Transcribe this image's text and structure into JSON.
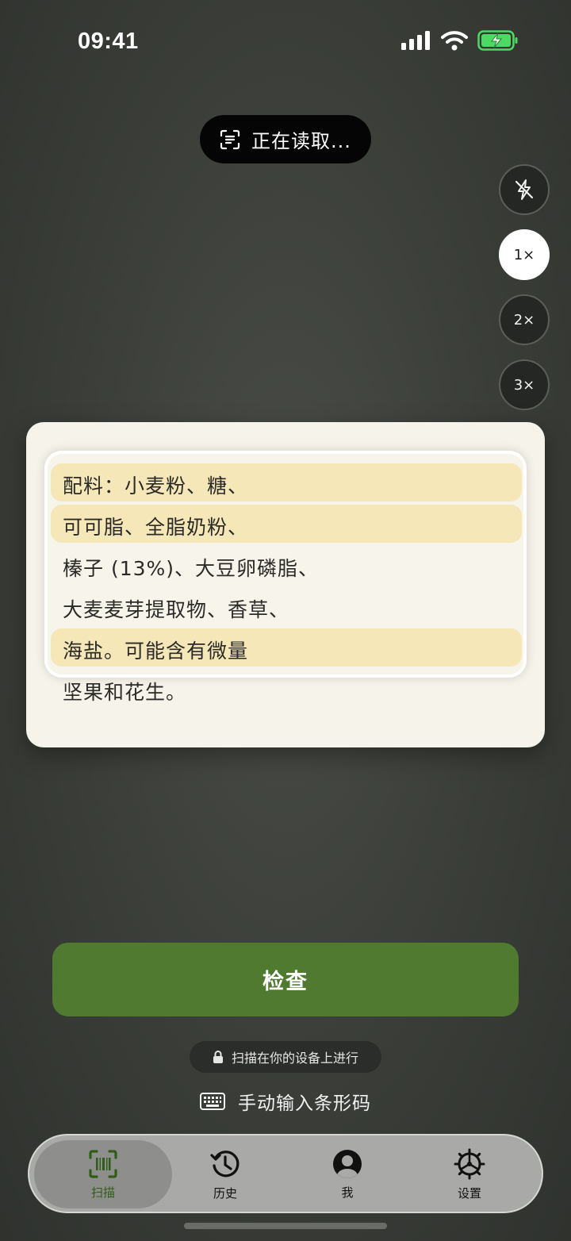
{
  "status_bar": {
    "time": "09:41"
  },
  "camera": {
    "reading_status": "正在读取...",
    "flash_icon": "flash-off-icon",
    "zoom_levels": [
      "1×",
      "2×",
      "3×"
    ],
    "selected_zoom": "1×"
  },
  "label_text": {
    "lines": [
      "配料：小麦粉、糖、",
      "可可脂、全脂奶粉、",
      "榛子 (13%)、大豆卵磷脂、",
      "大麦麦芽提取物、香草、",
      "海盐。可能含有微量",
      "坚果和花生。"
    ],
    "highlighted_lines": [
      0,
      1,
      4
    ]
  },
  "actions": {
    "check_label": "检查",
    "privacy_note": "扫描在你的设备上进行",
    "manual_entry_label": "手动输入条形码"
  },
  "tabs": [
    {
      "label": "扫描",
      "icon": "barcode-scan-icon",
      "active": true
    },
    {
      "label": "历史",
      "icon": "history-icon",
      "active": false
    },
    {
      "label": "我",
      "icon": "profile-icon",
      "active": false
    },
    {
      "label": "设置",
      "icon": "gear-icon",
      "active": false
    }
  ],
  "colors": {
    "accent": "#4f7a2f",
    "active_tab_text": "#2f5d16",
    "highlight": "#f5e6b4",
    "battery": "#4cd964"
  }
}
